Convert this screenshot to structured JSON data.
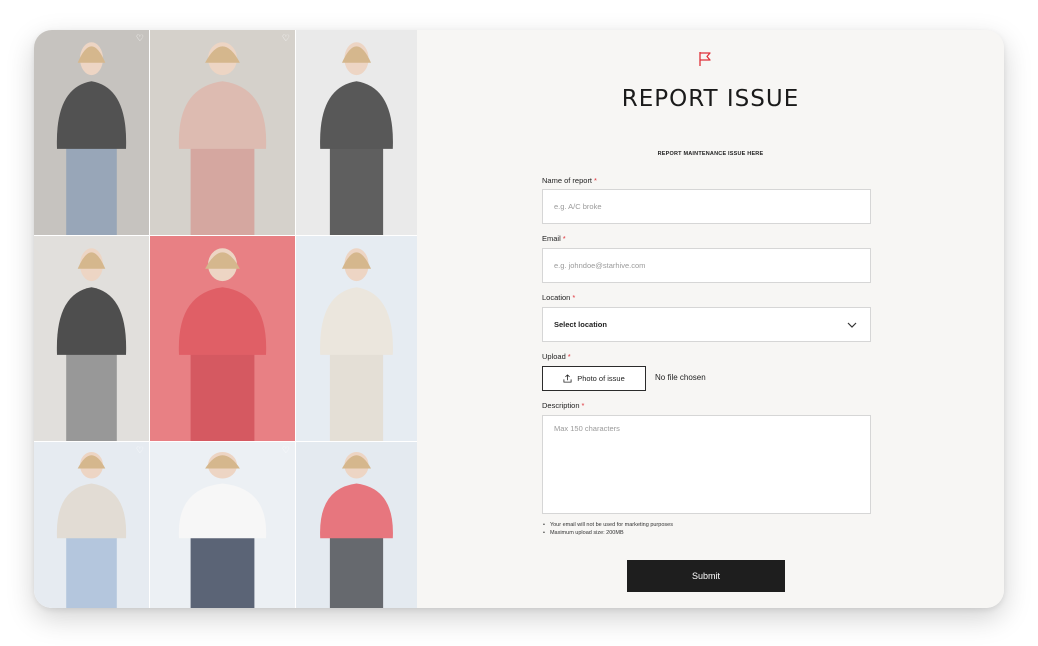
{
  "header": {
    "title": "REPORT ISSUE",
    "subtitle": "REPORT MAINTENANCE ISSUE HERE",
    "icon": "flag-icon",
    "accent_color": "#e0323a"
  },
  "form": {
    "name": {
      "label": "Name of report",
      "required_mark": "*",
      "placeholder": "e.g. A/C broke"
    },
    "email": {
      "label": "Email",
      "required_mark": "*",
      "placeholder": "e.g. johndoe@starhive.com"
    },
    "location": {
      "label": "Location",
      "required_mark": "*",
      "selected": "Select location"
    },
    "upload": {
      "label": "Upload",
      "required_mark": "*",
      "button": "Photo of issue",
      "status": "No file chosen"
    },
    "description": {
      "label": "Description",
      "required_mark": "*",
      "placeholder": "Max 150 characters"
    },
    "notes": [
      "Your email will not be used for marketing purposes",
      "Maximum upload size: 200MB"
    ],
    "submit": "Submit"
  },
  "gallery": {
    "photos": [
      {
        "name": "photo-black-blazer",
        "bg": "#b7b3ad",
        "top": "#222222",
        "bottom": "#7c8ea5"
      },
      {
        "name": "photo-pink-suit",
        "bg": "#c9c4bd",
        "top": "#d4a89c",
        "bottom": "#c98f86"
      },
      {
        "name": "photo-black-sweater",
        "bg": "#e4e4e4",
        "top": "#2a2a2a",
        "bottom": "#333333"
      },
      {
        "name": "photo-black-cardigan",
        "bg": "#d9d7d2",
        "top": "#1d1d1d",
        "bottom": "#7b7b7b"
      },
      {
        "name": "photo-red-jacket",
        "bg": "#e25d62",
        "top": "#d8323c",
        "bottom": "#c92b35"
      },
      {
        "name": "photo-cream-sweater",
        "bg": "#dfe7ef",
        "top": "#e6dfd4",
        "bottom": "#ddd6cb"
      },
      {
        "name": "photo-beige-turtleneck",
        "bg": "#dfe6ee",
        "top": "#dad3c8",
        "bottom": "#9fb6d4"
      },
      {
        "name": "photo-white-shirt",
        "bg": "#e7ecf1",
        "top": "#f5f5f5",
        "bottom": "#2d3950"
      },
      {
        "name": "photo-red-sweater",
        "bg": "#dde5ec",
        "top": "#e0505a",
        "bottom": "#3b3f46"
      }
    ]
  }
}
